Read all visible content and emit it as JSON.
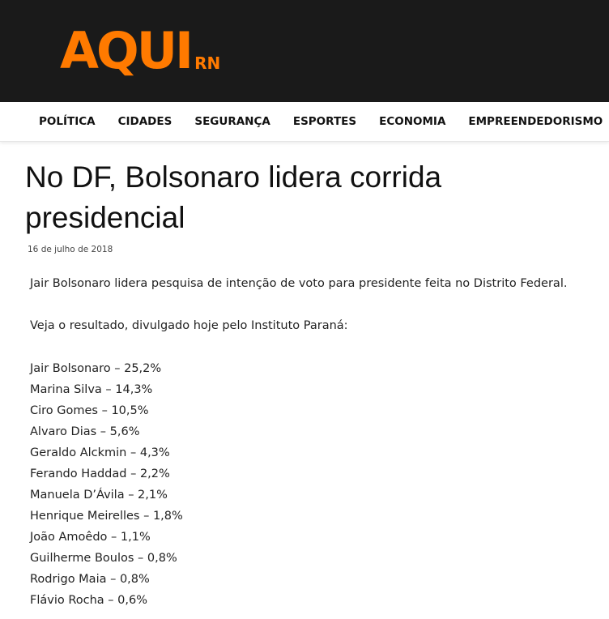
{
  "header": {
    "logo_main": "AQUI",
    "logo_sub": "RN"
  },
  "nav": {
    "items": [
      "POLÍTICA",
      "CIDADES",
      "SEGURANÇA",
      "ESPORTES",
      "ECONOMIA",
      "EMPREENDEDORISMO"
    ]
  },
  "article": {
    "title": "No DF, Bolsonaro lidera corrida presidencial",
    "date": "16 de julho de 2018",
    "intro": "Jair Bolsonaro lidera pesquisa de intenção de voto para presidente feita no Distrito Federal.",
    "lead": "Veja o resultado, divulgado hoje pelo Instituto Paraná:",
    "results": [
      "Jair Bolsonaro – 25,2%",
      "Marina Silva – 14,3%",
      "Ciro Gomes – 10,5%",
      "Alvaro Dias – 5,6%",
      "Geraldo Alckmin – 4,3%",
      "Ferando Haddad – 2,2%",
      "Manuela D’Ávila – 2,1%",
      "Henrique Meirelles – 1,8%",
      "João Amoêdo – 1,1%",
      "Guilherme Boulos – 0,8%",
      "Rodrigo Maia – 0,8%",
      "Flávio Rocha – 0,6%"
    ]
  },
  "colors": {
    "brand": "#ff7a00",
    "header_bg": "#1a1a1a"
  }
}
